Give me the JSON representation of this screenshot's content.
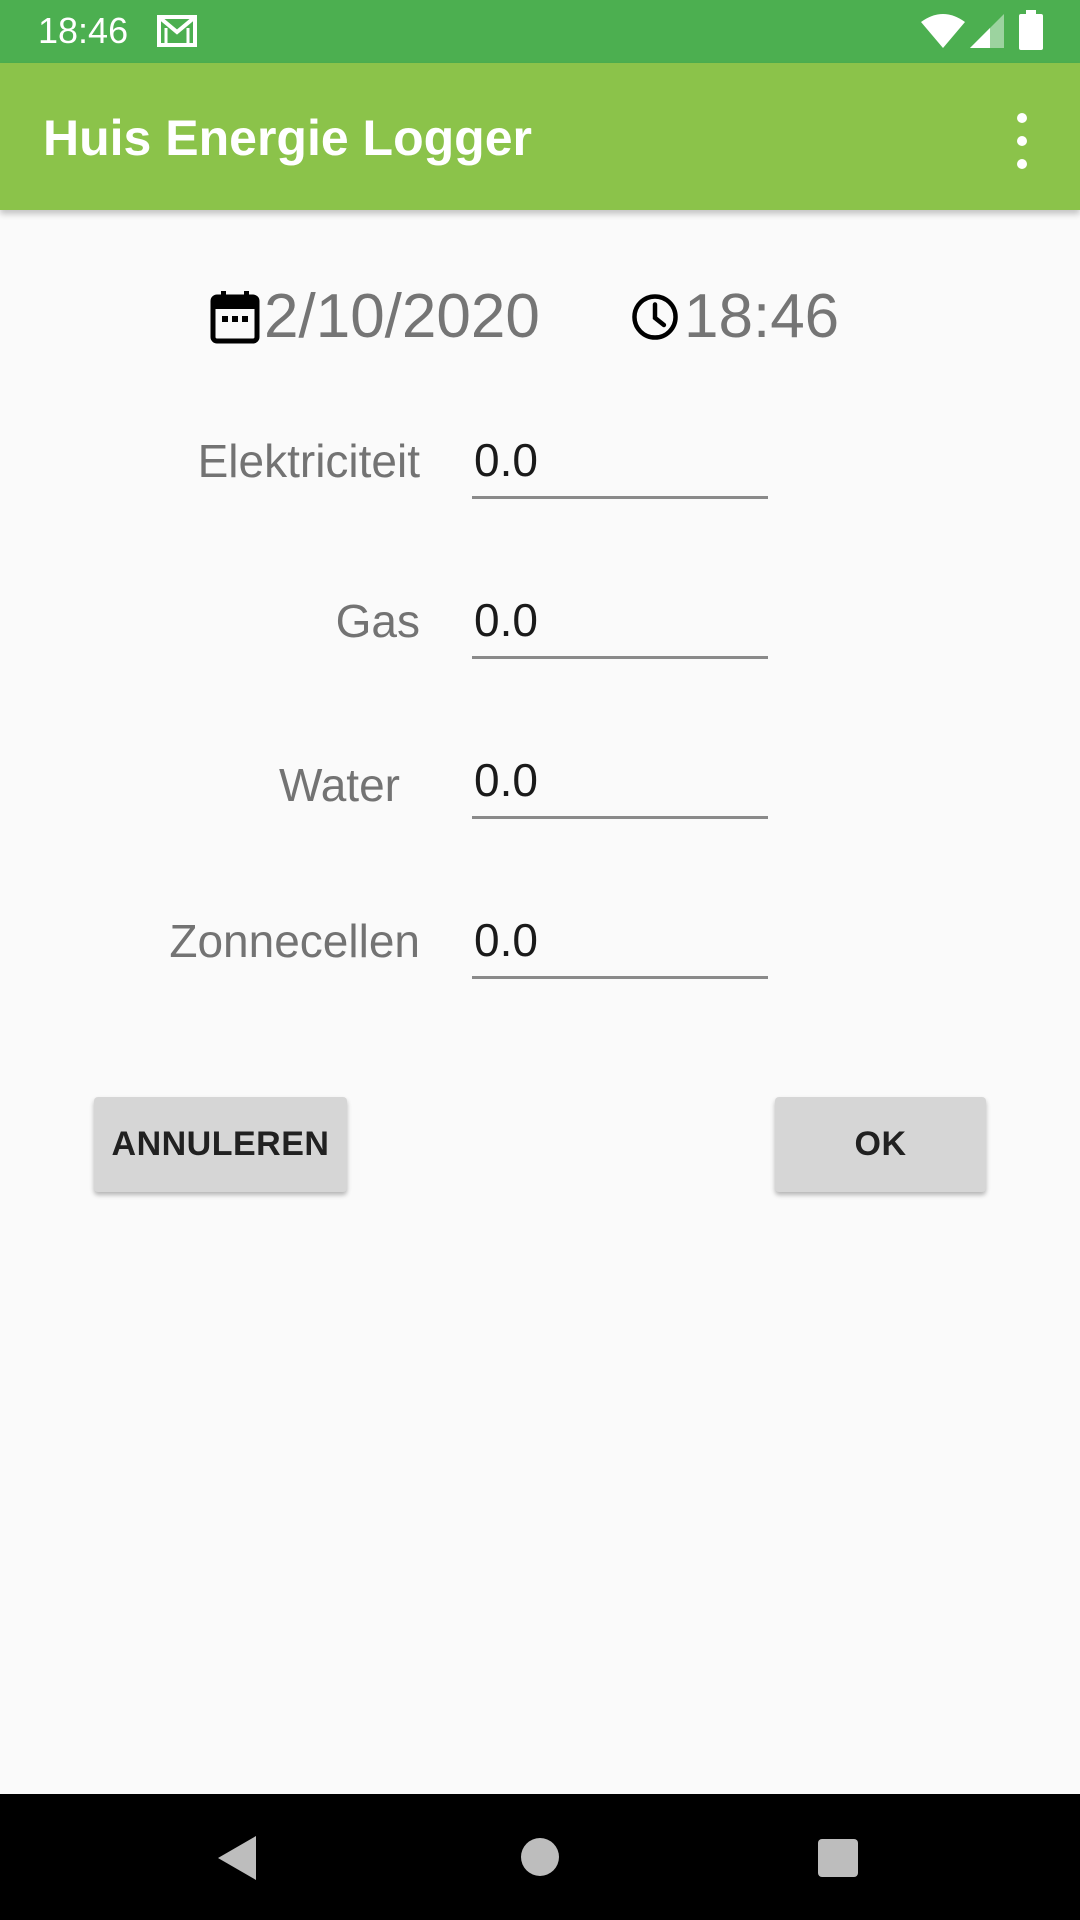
{
  "status_bar": {
    "time": "18:46",
    "icons": [
      "gmail-icon",
      "wifi-icon",
      "signal-icon",
      "battery-icon"
    ]
  },
  "app_bar": {
    "title": "Huis Energie Logger",
    "menu_icon": "overflow-menu-icon"
  },
  "datetime": {
    "date": "2/10/2020",
    "time": "18:46",
    "date_icon": "calendar-icon",
    "time_icon": "clock-icon"
  },
  "form": {
    "fields": [
      {
        "label": "Elektriciteit",
        "value": "0.0"
      },
      {
        "label": "Gas",
        "value": "0.0"
      },
      {
        "label": "Water",
        "value": "0.0"
      },
      {
        "label": "Zonnecellen",
        "value": "0.0"
      }
    ]
  },
  "buttons": {
    "cancel_label": "ANNULEREN",
    "ok_label": "OK"
  },
  "nav_bar": {
    "icons": [
      "back-icon",
      "home-icon",
      "recents-icon"
    ]
  },
  "colors": {
    "status_bar": "#4caf50",
    "app_bar": "#8bc34a",
    "background": "#fafafa",
    "button": "#d6d6d6"
  }
}
